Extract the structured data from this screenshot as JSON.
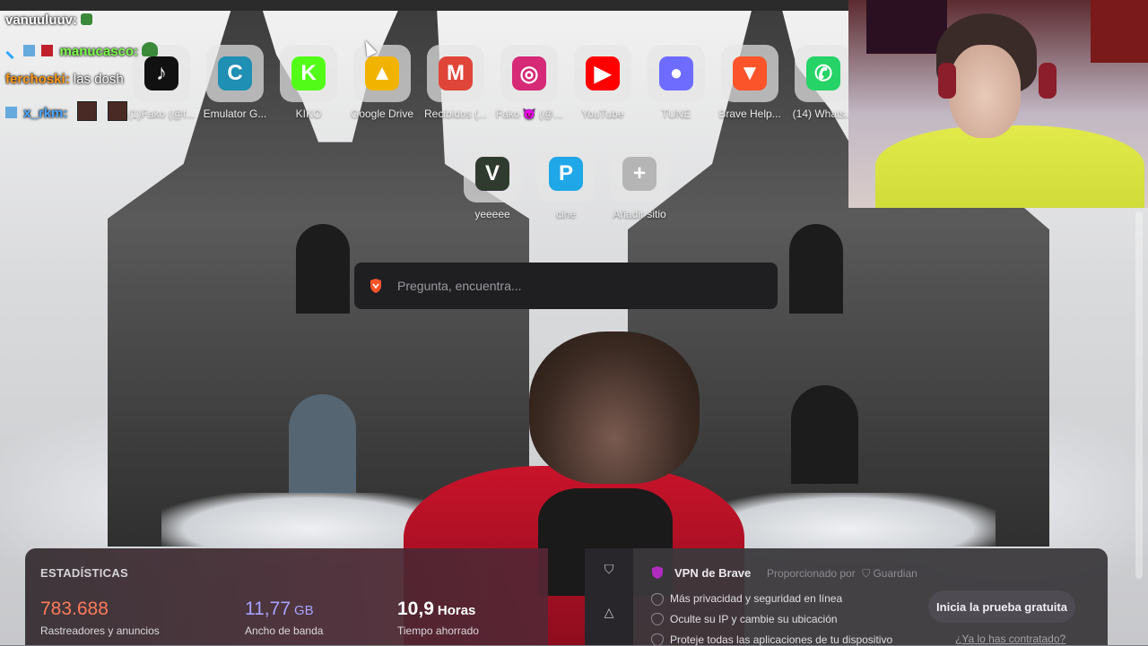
{
  "chat": [
    {
      "user": "vanuuluuv:",
      "color": "#ffffff",
      "message": ""
    },
    {
      "user": "manucasco:",
      "color": "#7cff4a",
      "message": ""
    },
    {
      "user": "ferchoski:",
      "color": "#ff9a1c",
      "message": "las dosh"
    },
    {
      "user": "x_rkm:",
      "color": "#4aa8ff",
      "message": ""
    }
  ],
  "tiles_row1": [
    {
      "label": "(1)Fako (@f...",
      "icon": "tiktok-icon",
      "glyph": "♪",
      "color": "#111111"
    },
    {
      "label": "Emulator G...",
      "icon": "emulator-icon",
      "glyph": "C",
      "color": "#1f8fb3"
    },
    {
      "label": "KIKO",
      "icon": "kick-icon",
      "glyph": "K",
      "color": "#53fc18"
    },
    {
      "label": "Google Drive",
      "icon": "google-drive-icon",
      "glyph": "▲",
      "color": "#f2b300"
    },
    {
      "label": "Recibidos (...",
      "icon": "gmail-icon",
      "glyph": "M",
      "color": "#e0453a"
    },
    {
      "label": "Fako 😈 (@...",
      "icon": "instagram-icon",
      "glyph": "◎",
      "color": "#d62976"
    },
    {
      "label": "YouTube",
      "icon": "youtube-icon",
      "glyph": "▶",
      "color": "#ff0000"
    },
    {
      "label": "TUNE",
      "icon": "tune-icon",
      "glyph": "●",
      "color": "#6d6cff"
    },
    {
      "label": "Brave Help...",
      "icon": "brave-icon",
      "glyph": "▼",
      "color": "#fb542b"
    },
    {
      "label": "(14) Whats...",
      "icon": "whatsapp-icon",
      "glyph": "✆",
      "color": "#25d366"
    }
  ],
  "tiles_row2": [
    {
      "label": "yeeeee",
      "icon": "v-icon",
      "glyph": "V",
      "color": "#2f3b2f"
    },
    {
      "label": "cine",
      "icon": "p-icon",
      "glyph": "P",
      "color": "#1fa7e8"
    },
    {
      "label": "Añadir sitio",
      "icon": "plus-icon",
      "glyph": "+",
      "color": "#b5b5b5"
    }
  ],
  "search": {
    "placeholder": "Pregunta, encuentra..."
  },
  "stats": {
    "title": "ESTADÍSTICAS",
    "trackers_value": "783.688",
    "trackers_label": "Rastreadores y anuncios",
    "bandwidth_value": "11,77",
    "bandwidth_unit": "GB",
    "bandwidth_label": "Ancho de banda",
    "time_value": "10,9",
    "time_unit": "Horas",
    "time_label": "Tiempo ahorrado",
    "colors": {
      "trackers": "#ff7a59",
      "bandwidth": "#a7a2ff",
      "time": "#ffffff"
    }
  },
  "vpn": {
    "title": "VPN de Brave",
    "provided_by": "Proporcionado por",
    "provider": "Guardian",
    "features": [
      "Más privacidad y seguridad en línea",
      "Oculte su IP y cambie su ubicación",
      "Proteje todas las aplicaciones de tu dispositivo"
    ],
    "cta": "Inicia la prueba gratuita",
    "link": "¿Ya lo has contratado?"
  }
}
